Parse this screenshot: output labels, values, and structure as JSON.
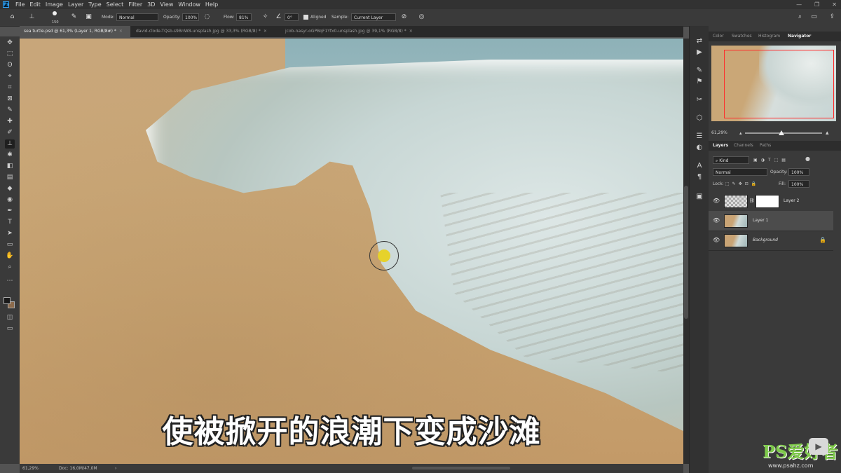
{
  "menubar": {
    "logo": "Ps",
    "items": [
      "File",
      "Edit",
      "Image",
      "Layer",
      "Type",
      "Select",
      "Filter",
      "3D",
      "View",
      "Window",
      "Help"
    ],
    "window_controls": [
      "—",
      "❐",
      "✕"
    ]
  },
  "options": {
    "brush_size": "150",
    "mode_label": "Mode:",
    "mode_value": "Normal",
    "opacity_label": "Opacity:",
    "opacity_value": "100%",
    "flow_label": "Flow:",
    "flow_value": "81%",
    "angle_value": "0°",
    "aligned_label": "Aligned",
    "sample_label": "Sample:",
    "sample_value": "Current Layer"
  },
  "tabs": [
    {
      "label": "sea turtle.psd @ 61,3% (Layer 1, RGB/8#) *",
      "active": true
    },
    {
      "label": "david-clode-TQsb-s9BnW8-unsplash.jpg @ 33,3% (RGB/8) *",
      "active": false
    },
    {
      "label": "jcob-nasyr-oGPBqF1Yfx0-unsplash.jpg @ 39,1% (RGB/8) *",
      "active": false
    }
  ],
  "tools": [
    "✥",
    "⬚",
    "ʘ",
    "⌖",
    "⌗",
    "⊠",
    "✎",
    "✚",
    "✐",
    "⊥",
    "✱",
    "◧",
    "▤",
    "◆",
    "◉",
    "✒",
    "T",
    "➤",
    "▭",
    "✋",
    "⌕",
    "⋯"
  ],
  "canvas": {
    "subtitle": "使被掀开的浪潮下变成沙滩"
  },
  "status": {
    "zoom": "61,29%",
    "doc": "Doc: 16,0M/47,0M"
  },
  "mid_icons": [
    "⇄",
    "▶",
    "✎",
    "⚑",
    "✂",
    "⬡",
    "☰",
    "◐",
    "A",
    "¶",
    "▣"
  ],
  "panels": {
    "top_tabs": [
      "Color",
      "Swatches",
      "Histogram",
      "Navigator"
    ],
    "active_top": "Navigator",
    "zoom_value": "61,29%",
    "layer_tabs": [
      "Layers",
      "Channels",
      "Paths"
    ],
    "kind_label": "Kind",
    "blend_mode": "Normal",
    "opacity_label": "Opacity:",
    "opacity_value": "100%",
    "lock_label": "Lock:",
    "fill_label": "Fill:",
    "fill_value": "100%",
    "layers": [
      {
        "name": "Layer 2",
        "selected": false
      },
      {
        "name": "Layer 1",
        "selected": true
      },
      {
        "name": "Background",
        "selected": false
      }
    ]
  },
  "watermark": {
    "brand": "PS爱好者",
    "url": "www.psahz.com"
  },
  "colors": {
    "accent": "#31a8ff",
    "nav_rect": "#ff2a2a",
    "cursor_dot": "#e6d22a",
    "watermark": "#7ec94b"
  }
}
